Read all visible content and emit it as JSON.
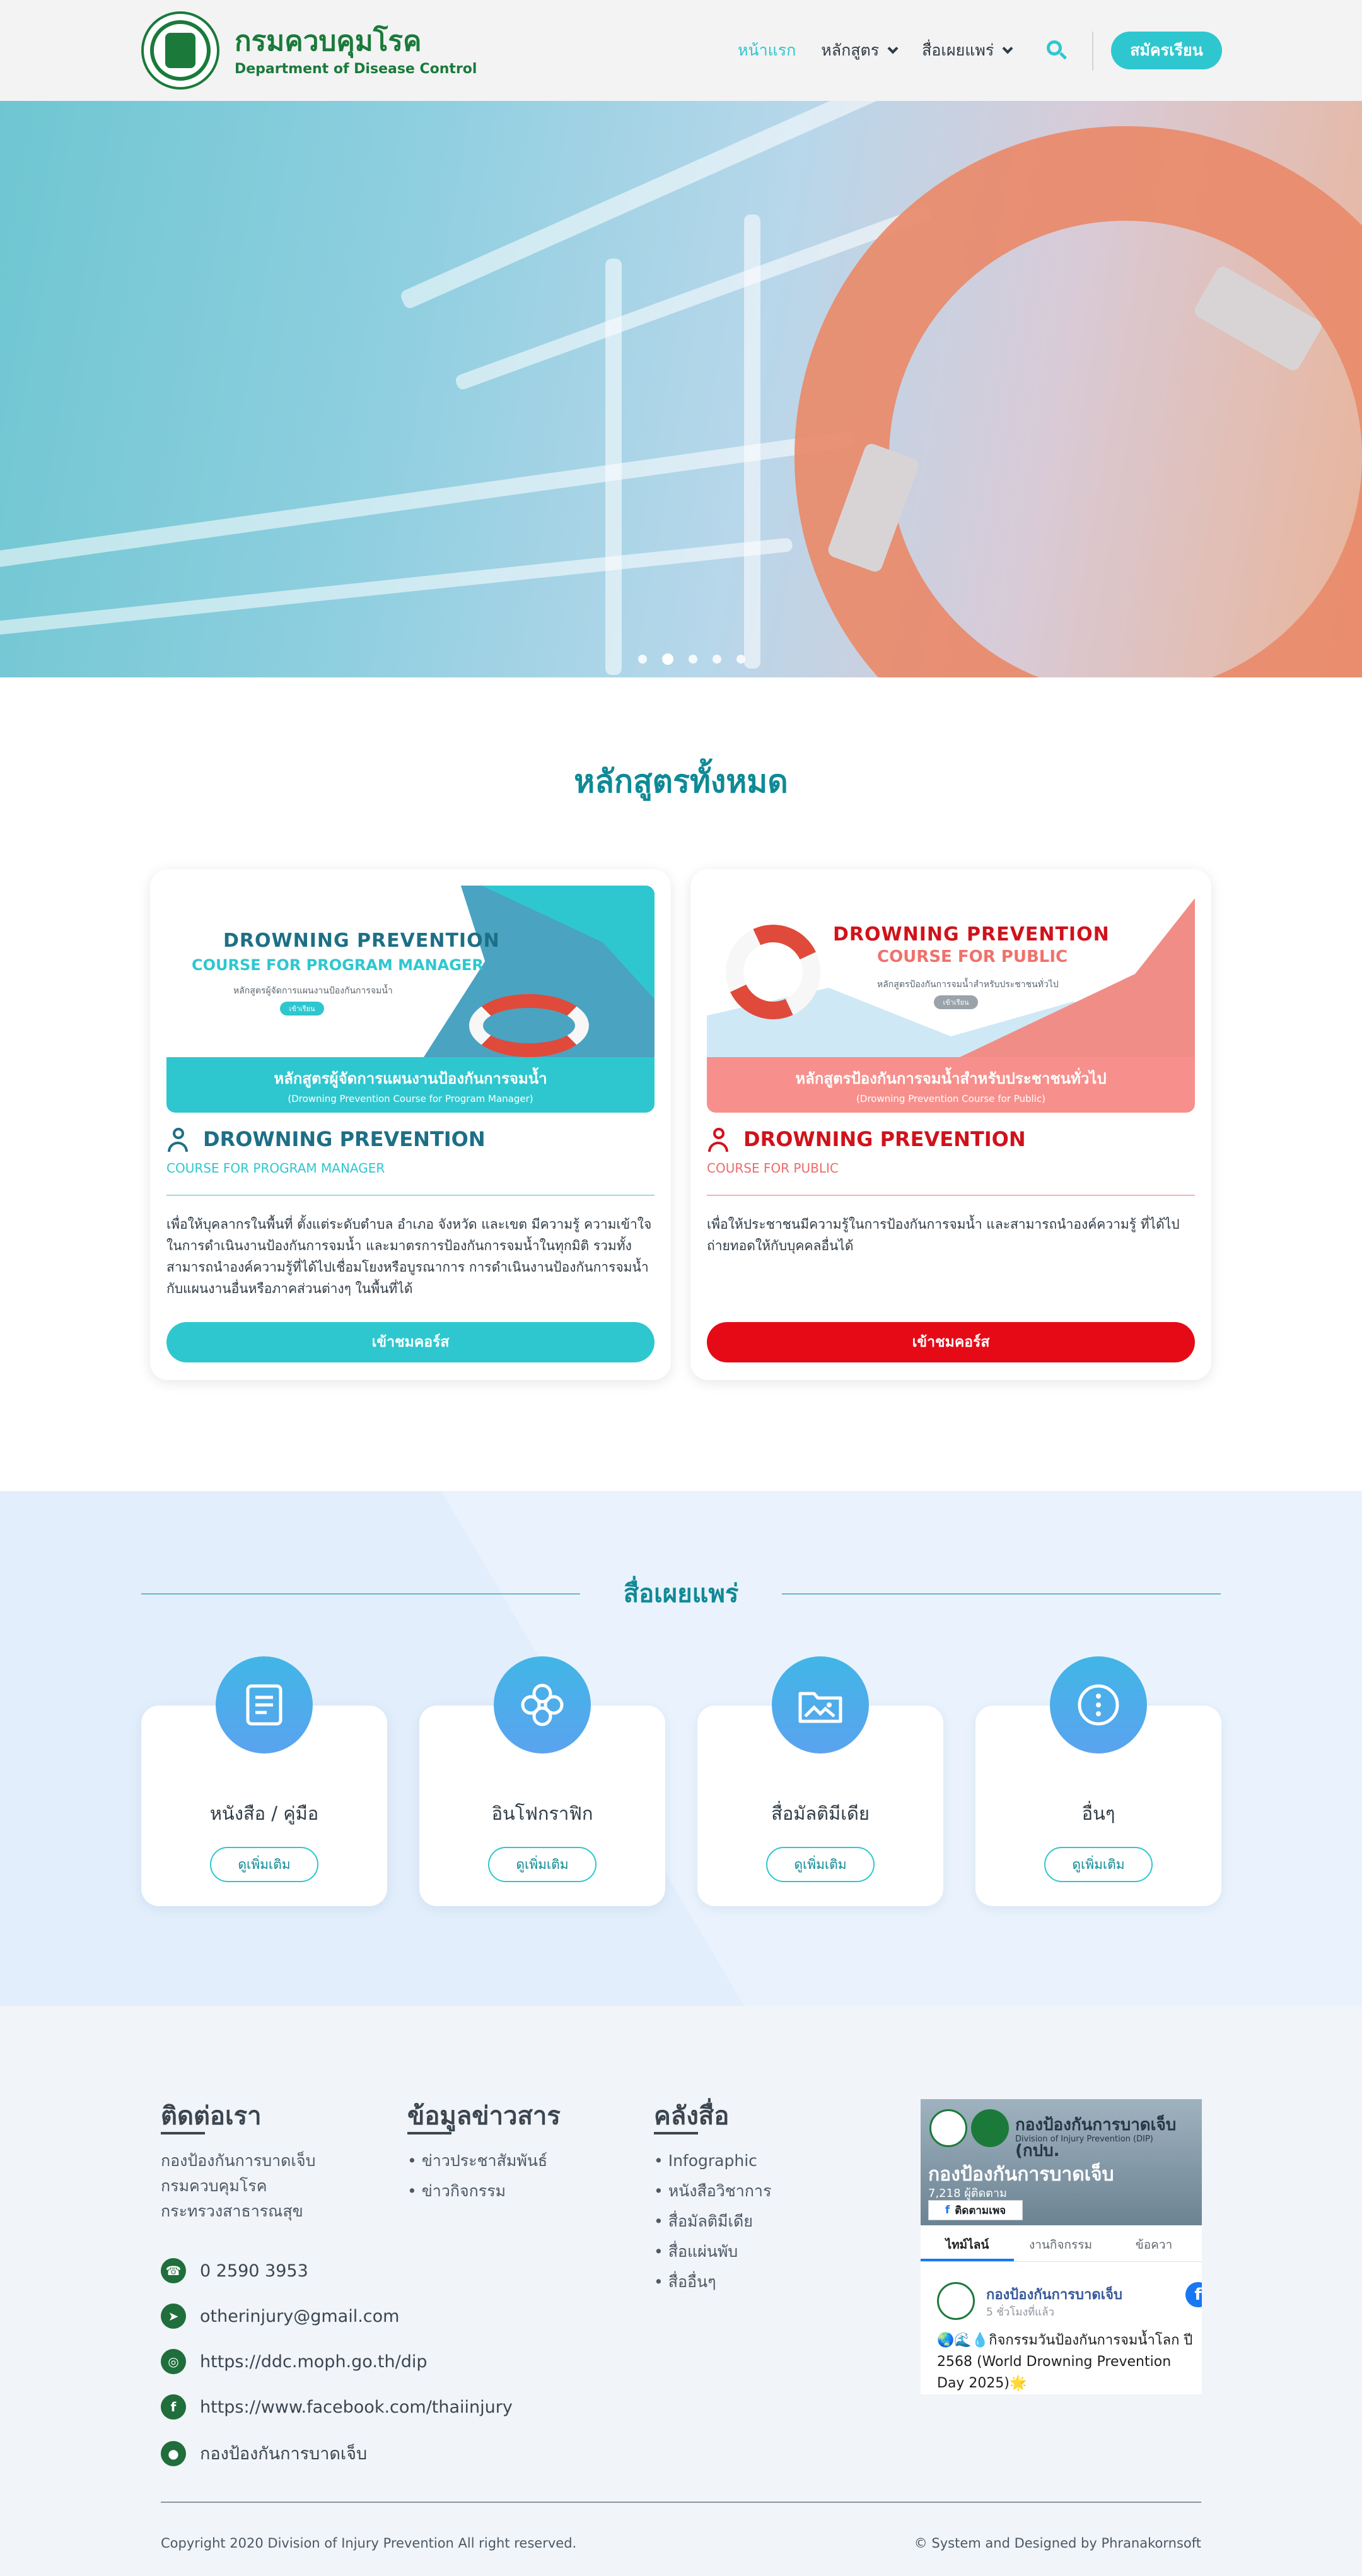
{
  "header": {
    "logo_th": "กรมควบคุมโรค",
    "logo_en": "Department of Disease Control",
    "nav": [
      {
        "label": "หน้าแรก",
        "active": true,
        "dropdown": false
      },
      {
        "label": "หลักสูตร",
        "active": false,
        "dropdown": true
      },
      {
        "label": "สื่อเผยแพร่",
        "active": false,
        "dropdown": true
      }
    ],
    "search_icon": "search-icon",
    "signup_label": "สมัครเรียน"
  },
  "hero": {
    "slide_count": 5,
    "active_slide": 2
  },
  "courses": {
    "title": "หลักสูตรทั้งหมด",
    "items": [
      {
        "banner_title_1": "DROWNING PREVENTION",
        "banner_title_2": "COURSE FOR PROGRAM MANAGER",
        "banner_subtitle": "หลักสูตรผู้จัดการแผนงานป้องกันการจมน้ำ",
        "banner_pill": "เข้าเรียน",
        "banner_strip_1": "หลักสูตรผู้จัดการแผนงานป้องกันการจมน้ำ",
        "banner_strip_2": "(Drowning Prevention Course for Program Manager)",
        "name": "DROWNING PREVENTION",
        "subtitle": "COURSE FOR PROGRAM MANAGER",
        "description": "เพื่อให้บุคลากรในพื้นที่ ตั้งแต่ระดับตำบล อำเภอ จังหวัด และเขต มีความรู้ ความเข้าใจในการดำเนินงานป้องกันการจมน้ำ และมาตรการป้องกันการจมน้ำในทุกมิติ รวมทั้งสามารถนำองค์ความรู้ที่ได้ไปเชื่อมโยงหรือบูรณาการ การดำเนินงานป้องกันการจมน้ำกับแผนงานอื่นหรือภาคส่วนต่างๆ ในพื้นที่ได้",
        "button": "เข้าชมคอร์ส",
        "accent": "#2fc7cf",
        "heading_color": "#1d6f86",
        "icon": "person-location-icon"
      },
      {
        "banner_title_1": "DROWNING PREVENTION",
        "banner_title_2": "COURSE FOR PUBLIC",
        "banner_subtitle": "หลักสูตรป้องกันการจมน้ำสำหรับประชาชนทั่วไป",
        "banner_pill": "เข้าเรียน",
        "banner_strip_1": "หลักสูตรป้องกันการจมน้ำสำหรับประชาชนทั่วไป",
        "banner_strip_2": "(Drowning Prevention Course for Public)",
        "name": "DROWNING PREVENTION",
        "subtitle": "COURSE FOR PUBLIC",
        "description": "เพื่อให้ประชาชนมีความรู้ในการป้องกันการจมน้ำ และสามารถนำองค์ความรู้ ที่ได้ไปถ่ายทอดให้กับบุคคลอื่นได้",
        "button": "เข้าชมคอร์ส",
        "accent": "#e60a17",
        "heading_color": "#d0121b",
        "icon": "people-icon"
      }
    ]
  },
  "media": {
    "title": "สื่อเผยแพร่",
    "items": [
      {
        "label": "หนังสือ / คู่มือ",
        "button": "ดูเพิ่มเติม",
        "icon": "document-icon"
      },
      {
        "label": "อินโฟกราฟิก",
        "button": "ดูเพิ่มเติม",
        "icon": "infographic-icon"
      },
      {
        "label": "สื่อมัลติมีเดีย",
        "button": "ดูเพิ่มเติม",
        "icon": "folder-image-icon"
      },
      {
        "label": "อื่นๆ",
        "button": "ดูเพิ่มเติม",
        "icon": "more-icon"
      }
    ]
  },
  "footer": {
    "contact": {
      "title": "ติดต่อเรา",
      "org_lines": [
        "กองป้องกันการบาดเจ็บ",
        "กรมควบคุมโรค",
        "กระทรวงสาธารณสุข"
      ],
      "phone": "0 2590 3953",
      "email": "otherinjury@gmail.com",
      "website": "https://ddc.moph.go.th/dip",
      "facebook": "https://www.facebook.com/thaiinjury",
      "line": "กองป้องกันการบาดเจ็บ"
    },
    "news": {
      "title": "ข้อมูลข่าวสาร",
      "items": [
        "ข่าวประชาสัมพันธ์",
        "ข่าวกิจกรรม"
      ]
    },
    "library": {
      "title": "คลังสื่อ",
      "items": [
        "Infographic",
        "หนังสือวิชาการ",
        "สื่อมัลติมีเดีย",
        "สื่อแผ่นพับ",
        "สื่ออื่นๆ"
      ]
    },
    "facebook_widget": {
      "cover_title": "กองป้องกันการบาดเจ็บ (กปบ.",
      "cover_subtitle": "Division of Injury Prevention (DIP)",
      "page_name": "กองป้องกันการบาดเจ็บ",
      "likes": "7,218 ผู้ติดตาม",
      "like_button": "ติดตามเพจ",
      "tabs": [
        "ไทม์ไลน์",
        "งานกิจกรรม",
        "ข้อควา"
      ],
      "post_author": "กองป้องกันการบาดเจ็บ",
      "post_time": "5 ชั่วโมงที่แล้ว",
      "post_text": "🌏🌊💧กิจกรรมวันป้องกันการจมน้ำโลก ปี 2568 (World Drowning Prevention Day 2025)🌟"
    },
    "copyright": "Copyright 2020 Division of Injury Prevention All right reserved.",
    "designed_by": "© System and Designed by Phranakornsoft"
  }
}
